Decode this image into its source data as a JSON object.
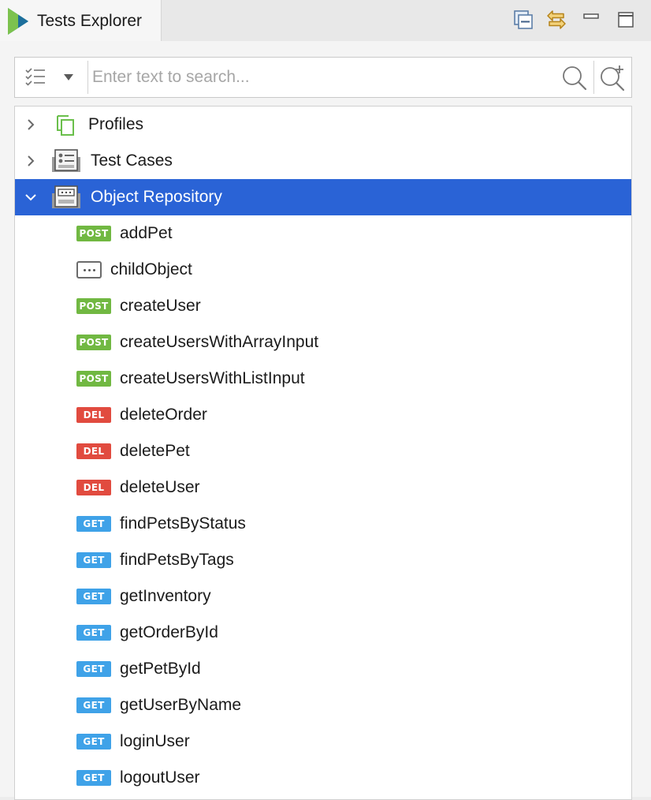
{
  "colors": {
    "selection": "#2a63d6",
    "post": "#71b842",
    "delete": "#e14b3f",
    "get": "#3fa2e8"
  },
  "tab": {
    "title": "Tests Explorer",
    "logo_icon": "katalon-logo-icon"
  },
  "toolbar": {
    "collapse_all_icon": "collapse-all-icon",
    "link_editor_icon": "link-with-editor-icon",
    "minimize_icon": "minimize-icon",
    "maximize_icon": "maximize-icon"
  },
  "search": {
    "placeholder": "Enter text to search...",
    "value": "",
    "filter_icon": "filter-checklist-icon",
    "dropdown_icon": "caret-down-icon",
    "search_icon": "search-icon",
    "advanced_search_icon": "advanced-search-icon"
  },
  "tree": {
    "roots": [
      {
        "label": "Profiles",
        "expanded": false,
        "icon": "profiles-icon"
      },
      {
        "label": "Test Cases",
        "expanded": false,
        "icon": "test-cases-icon"
      },
      {
        "label": "Object Repository",
        "expanded": true,
        "selected": true,
        "icon": "object-repository-icon"
      }
    ],
    "children": [
      {
        "method": "POST",
        "label": "addPet"
      },
      {
        "method": "",
        "label": "childObject"
      },
      {
        "method": "POST",
        "label": "createUser"
      },
      {
        "method": "POST",
        "label": "createUsersWithArrayInput"
      },
      {
        "method": "POST",
        "label": "createUsersWithListInput"
      },
      {
        "method": "DEL",
        "label": "deleteOrder"
      },
      {
        "method": "DEL",
        "label": "deletePet"
      },
      {
        "method": "DEL",
        "label": "deleteUser"
      },
      {
        "method": "GET",
        "label": "findPetsByStatus"
      },
      {
        "method": "GET",
        "label": "findPetsByTags"
      },
      {
        "method": "GET",
        "label": "getInventory"
      },
      {
        "method": "GET",
        "label": "getOrderById"
      },
      {
        "method": "GET",
        "label": "getPetById"
      },
      {
        "method": "GET",
        "label": "getUserByName"
      },
      {
        "method": "GET",
        "label": "loginUser"
      },
      {
        "method": "GET",
        "label": "logoutUser"
      }
    ]
  }
}
